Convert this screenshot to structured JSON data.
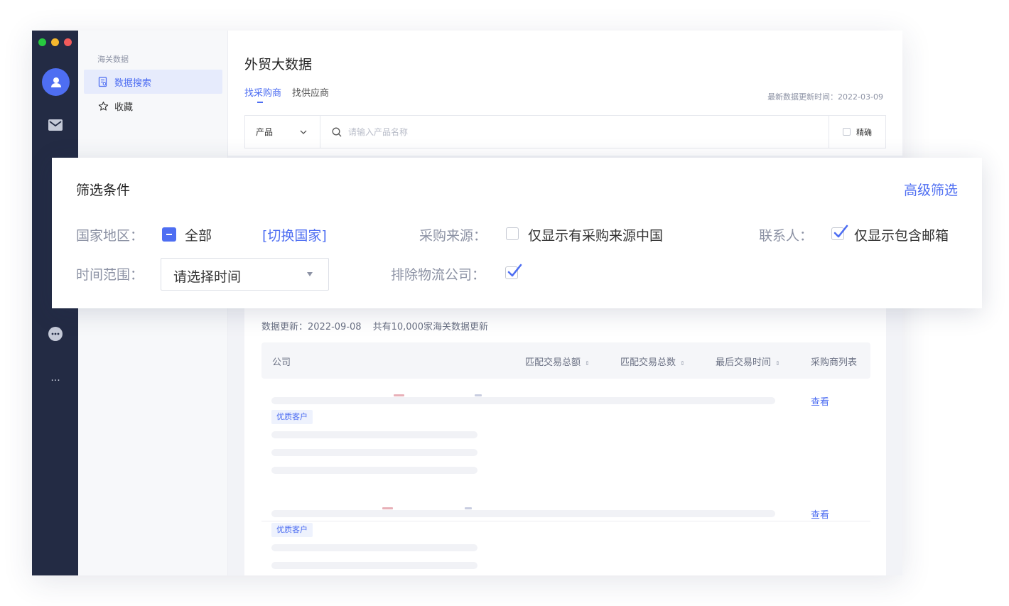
{
  "sidebar": {
    "section_title": "海关数据",
    "items": [
      {
        "label": "数据搜索",
        "icon": "document-search-icon",
        "active": true
      },
      {
        "label": "收藏",
        "icon": "star-icon",
        "active": false
      }
    ]
  },
  "rail": {
    "icons": [
      "avatar-icon",
      "mail-icon",
      "chat-icon",
      "more-icon"
    ],
    "more_label": "···"
  },
  "main": {
    "title": "外贸大数据",
    "tabs": [
      {
        "label": "找采购商",
        "active": true
      },
      {
        "label": "找供应商",
        "active": false
      }
    ],
    "update_time": "最新数据更新时间：2022-03-09",
    "search": {
      "type_label": "产品",
      "placeholder": "请输入产品名称",
      "precise_label": "精确"
    }
  },
  "filter": {
    "title": "筛选条件",
    "advanced_label": "高级筛选",
    "country": {
      "label": "国家地区：",
      "value": "全部",
      "switch_link": "[切换国家]"
    },
    "source": {
      "label": "采购来源：",
      "option": "仅显示有采购来源中国",
      "checked": false
    },
    "contact": {
      "label": "联系人：",
      "option": "仅显示包含邮箱",
      "checked": true
    },
    "time": {
      "label": "时间范围：",
      "placeholder": "请选择时间"
    },
    "exclude_logistics": {
      "label": "排除物流公司：",
      "checked": true
    }
  },
  "results": {
    "data_update": "数据更新：2022-09-08",
    "count_text": "共有10,000家海关数据更新",
    "columns": [
      "公司",
      "匹配交易总额",
      "匹配交易总数",
      "最后交易时间",
      "采购商列表"
    ],
    "sort_glyph": "⇕",
    "rows": [
      {
        "tag": "优质客户",
        "action": "查看"
      },
      {
        "tag": "优质客户",
        "action": "查看"
      }
    ]
  },
  "colors": {
    "accent": "#4e6ef2",
    "rail_bg": "#232b44",
    "traffic_red": "#f25b5b",
    "traffic_yellow": "#f5b82e",
    "traffic_green": "#27c93f"
  }
}
